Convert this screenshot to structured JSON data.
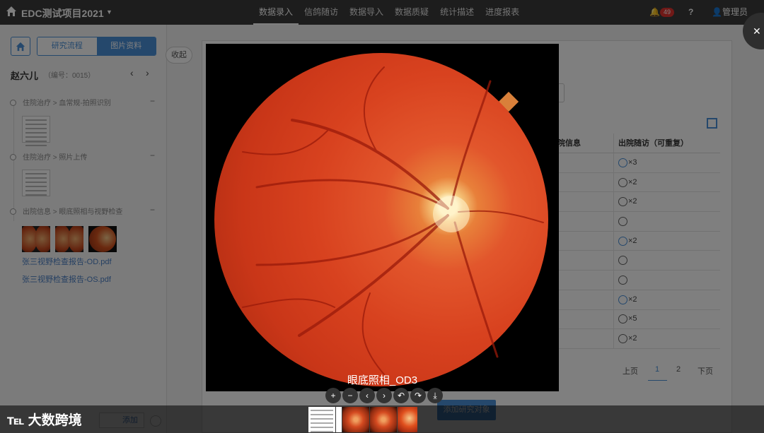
{
  "topbar": {
    "title": "EDC测试项目2021",
    "nav": [
      "数据录入",
      "信鸽随访",
      "数据导入",
      "数据质疑",
      "统计描述",
      "进度报表"
    ],
    "active_nav": "数据录入",
    "notif_count": "49",
    "user": "管理员"
  },
  "sidebar": {
    "seg_tabs": [
      "研究流程",
      "图片资料"
    ],
    "patient_name": "赵六儿",
    "patient_id": "（编号：0015）",
    "timeline": [
      "住院治疗 > 血常规-拍照识别",
      "住院治疗 > 照片上传",
      "出院信息 > 眼底照相与视野检查"
    ],
    "pdfs": [
      "张三视野检查报告-OD.pdf",
      "张三视野检查报告-OS.pdf"
    ],
    "collapse": "收起",
    "add": "添加"
  },
  "table": {
    "headers": [
      "院信息",
      "出院随访（可重复）"
    ],
    "rows": [
      {
        "icon": "clock-icon",
        "count": "×3"
      },
      {
        "icon": "edit-icon",
        "count": "×2"
      },
      {
        "icon": "edit-icon",
        "count": "×2"
      },
      {
        "icon": "edit-icon",
        "count": ""
      },
      {
        "icon": "clock-icon",
        "count": "×2"
      },
      {
        "icon": "edit-icon",
        "count": ""
      },
      {
        "icon": "edit-icon",
        "count": ""
      },
      {
        "icon": "clock-icon",
        "count": "×2"
      },
      {
        "icon": "edit-icon",
        "count": "×5"
      },
      {
        "icon": "edit-icon",
        "count": "×2"
      }
    ],
    "pager": {
      "prev": "上页",
      "p1": "1",
      "p2": "2",
      "next": "下页"
    }
  },
  "add_subject_button": "添加研究对象",
  "viewer": {
    "caption": "眼底照相_OD3",
    "tools": [
      "zoom-in-icon",
      "zoom-out-icon",
      "prev-icon",
      "next-icon",
      "rotate-left-icon",
      "rotate-right-icon",
      "download-icon"
    ]
  },
  "footer": {
    "logo": "大数跨境"
  }
}
